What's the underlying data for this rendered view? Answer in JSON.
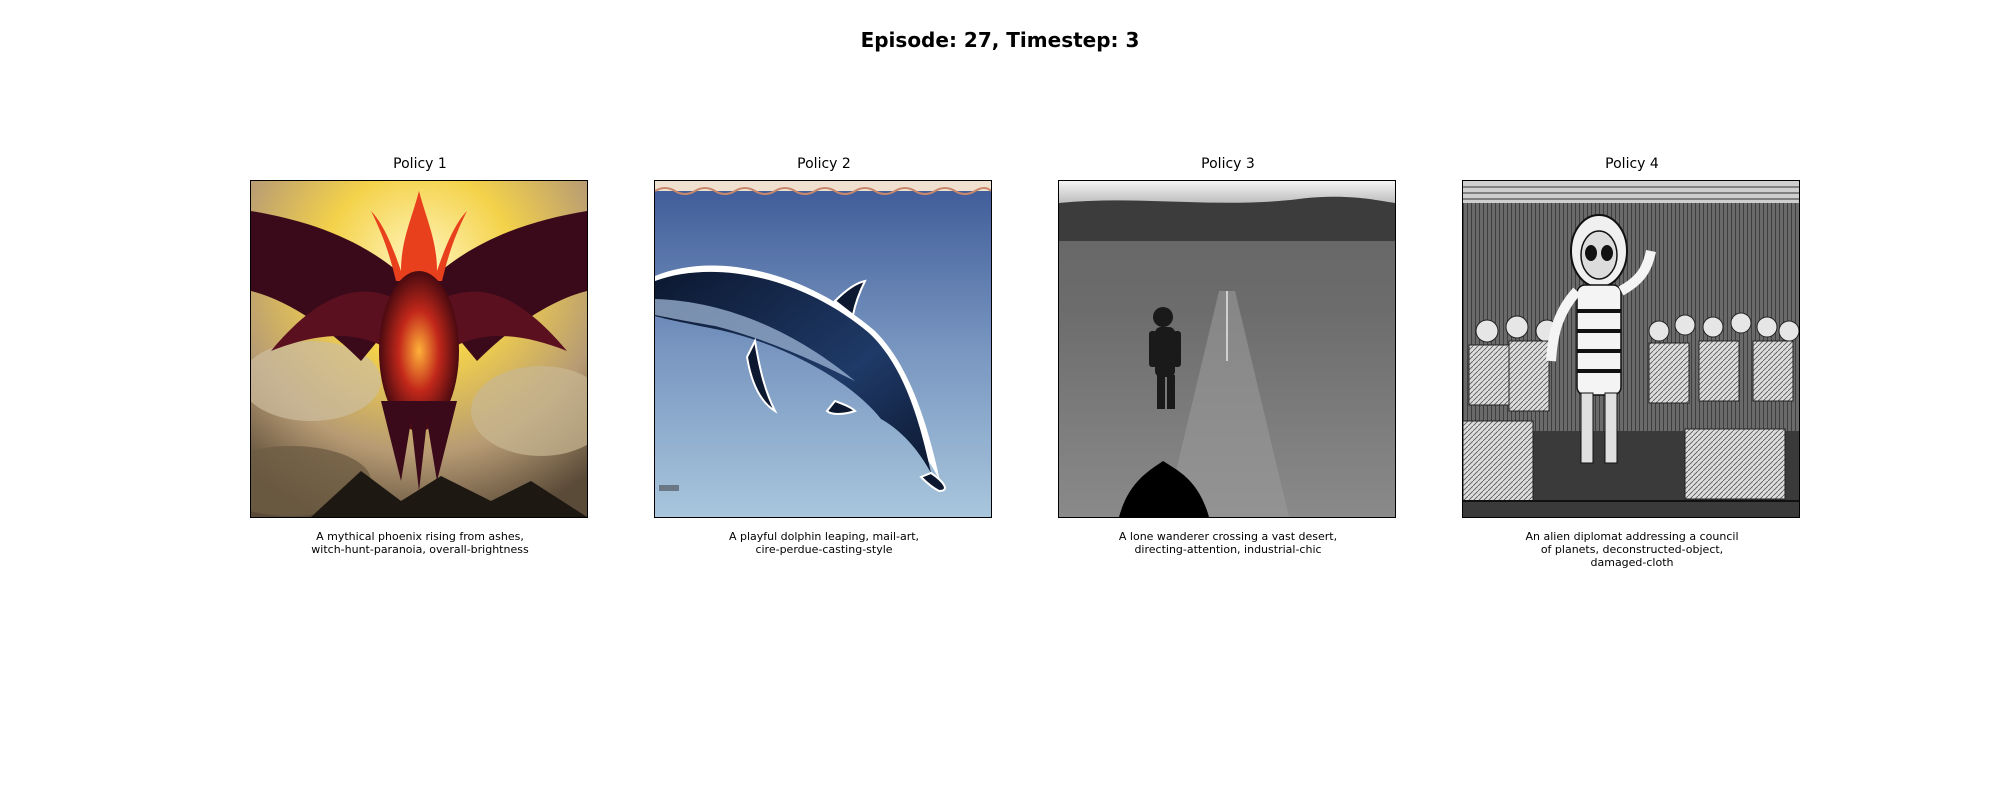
{
  "figure": {
    "title": "Episode: 27, Timestep: 3"
  },
  "panels": [
    {
      "title": "Policy 1",
      "caption": "A mythical phoenix rising from ashes,\nwitch-hunt-paranoia, overall-brightness",
      "image": "phoenix-image"
    },
    {
      "title": "Policy 2",
      "caption": "A playful dolphin leaping, mail-art,\ncire-perdue-casting-style",
      "image": "dolphin-image"
    },
    {
      "title": "Policy 3",
      "caption": "A lone wanderer crossing a vast desert,\ndirecting-attention, industrial-chic",
      "image": "wanderer-image"
    },
    {
      "title": "Policy 4",
      "caption": "An alien diplomat addressing a council\nof planets, deconstructed-object,\ndamaged-cloth",
      "image": "alien-diplomat-image"
    }
  ]
}
